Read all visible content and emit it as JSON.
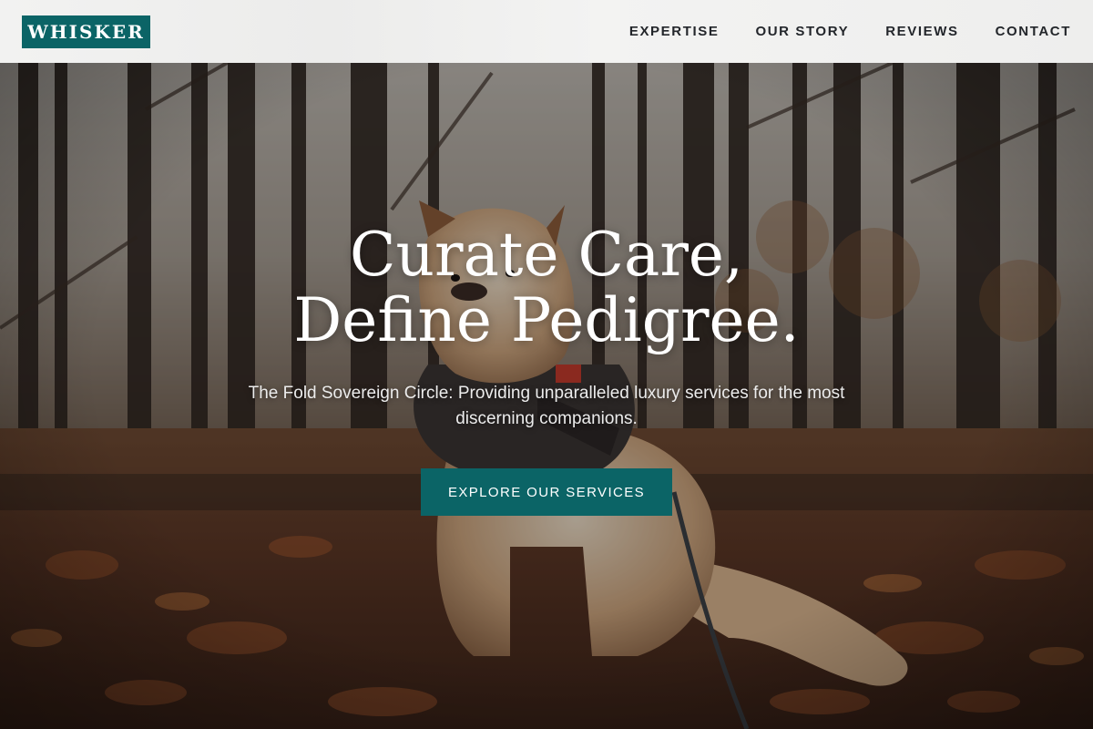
{
  "brand": {
    "logo_text": "WHISKER",
    "accent_color": "#0b6466"
  },
  "nav": {
    "items": [
      {
        "label": "EXPERTISE"
      },
      {
        "label": "OUR STORY"
      },
      {
        "label": "REVIEWS"
      },
      {
        "label": "CONTACT"
      }
    ]
  },
  "hero": {
    "headline_line1": "Curate Care,",
    "headline_line2": "Define Pedigree.",
    "subheadline": "The Fold Sovereign Circle: Providing unparalleled luxury services for the most discerning companions.",
    "cta_label": "EXPLORE OUR SERVICES",
    "image_alt": "Dog in a service harness sitting among autumn leaves in a forest"
  }
}
